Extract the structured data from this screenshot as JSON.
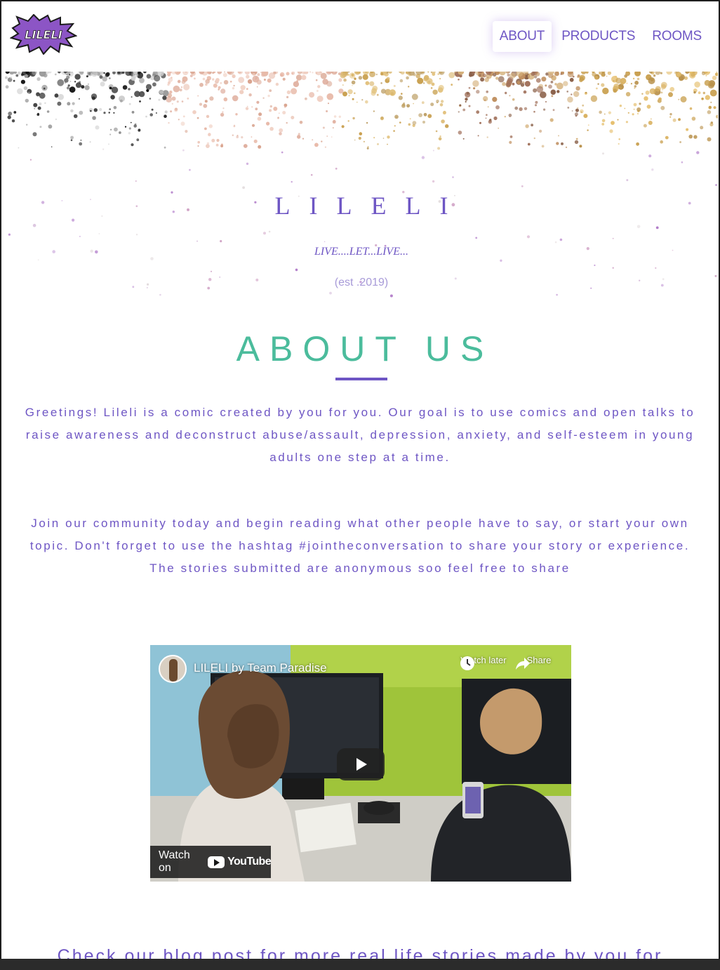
{
  "brand": {
    "logo_text": "LILELI",
    "logo_color": "#8c55c5"
  },
  "nav": {
    "items": [
      {
        "label": "ABOUT",
        "active": true
      },
      {
        "label": "PRODUCTS",
        "active": false
      },
      {
        "label": "ROOMS",
        "active": false
      }
    ]
  },
  "hero": {
    "title": "LILELI",
    "tagline": "LIVE....LET...LIVE...",
    "established": "(est .2019)"
  },
  "about": {
    "heading": "ABOUT US",
    "paragraph1": "Greetings! Lileli is a comic created by you for you. Our goal is to use comics and open talks to raise awareness and deconstruct abuse/assault, depression, anxiety, and self-esteem in young adults one step at a time.",
    "paragraph2": "Join our community today and begin reading what other people have to say, or start your own topic. Don't forget to use the hashtag #jointheconversation to share your story or experience. The stories submitted are anonymous soo feel free to share"
  },
  "video": {
    "title": "LILELI by Team Paradise",
    "watch_later": "Watch later",
    "share": "Share",
    "watch_on": "Watch on",
    "youtube": "YouTube"
  },
  "blog": {
    "text": "Check our blog post for more real life stories made by you for"
  },
  "colors": {
    "accent_purple": "#6e56c4",
    "heading_teal": "#4bbc9c",
    "muted_purple": "#a79ad8"
  }
}
